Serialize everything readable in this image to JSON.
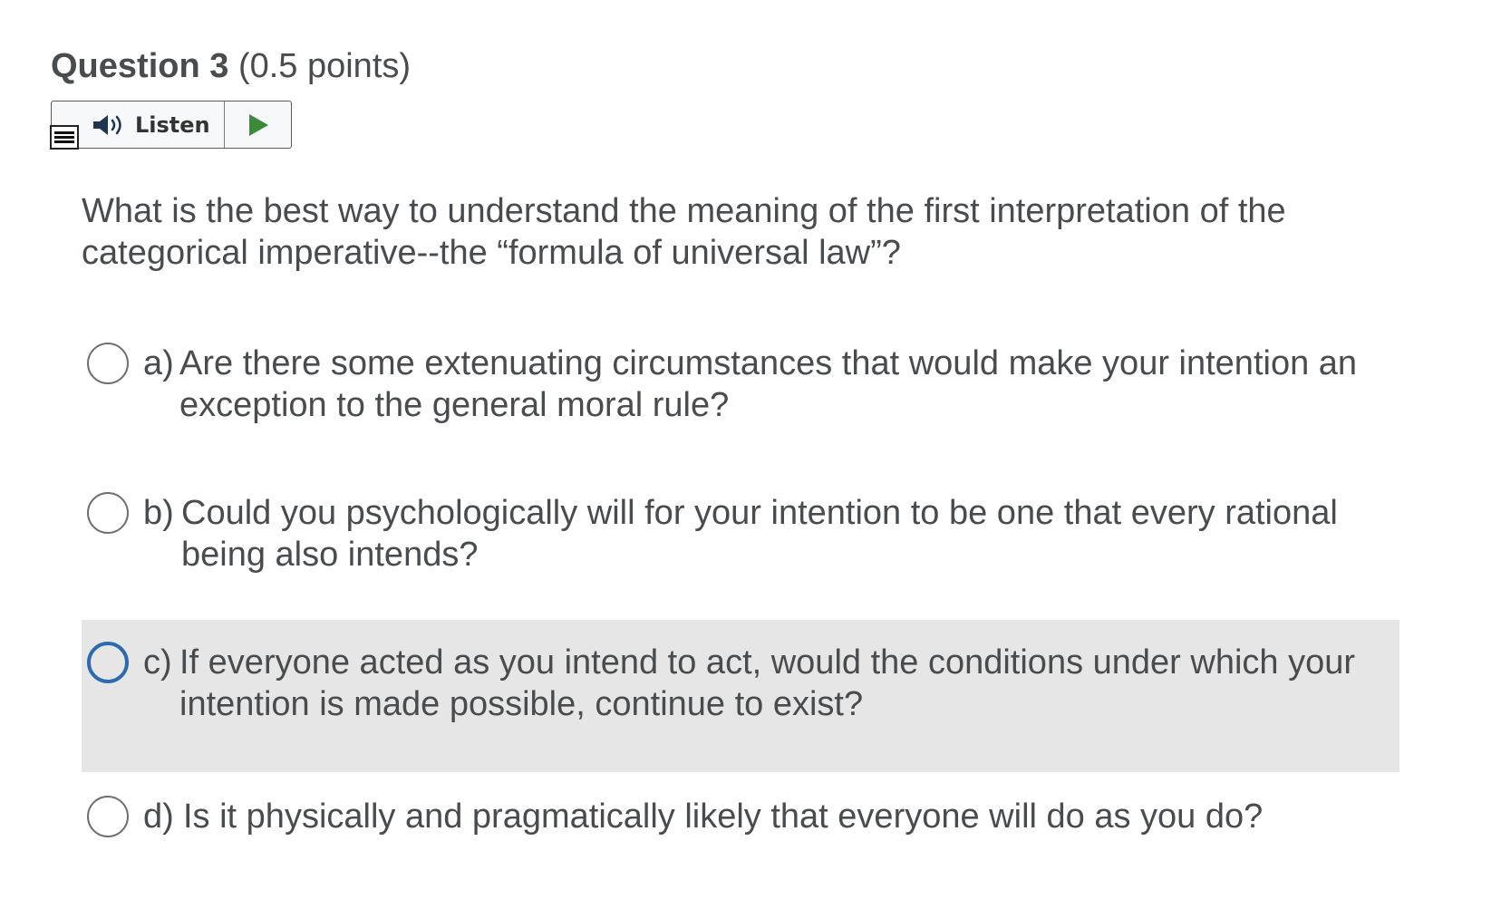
{
  "question": {
    "title": "Question 3",
    "points": "(0.5 points)"
  },
  "listen": {
    "label": "Listen",
    "menu_icon": "menu-lines-icon",
    "speaker_icon": "speaker-icon",
    "play_icon": "play-icon",
    "play_color": "#3a8a3a"
  },
  "prompt": "What is the best way to understand the meaning of the first interpretation of the categorical imperative--the “formula of universal law”?",
  "options": [
    {
      "letter": "a)",
      "text": "Are there some extenuating circumstances that would make your intention an exception to the general moral rule?",
      "selected": false
    },
    {
      "letter": "b)",
      "text": "Could you psychologically will for your intention to be one that every rational being also intends?",
      "selected": false
    },
    {
      "letter": "c)",
      "text": "If everyone acted as you intend to act, would the conditions under which your intention is made possible, continue to exist?",
      "selected": false,
      "highlighted": true
    },
    {
      "letter": "d)",
      "text": "Is it physically and pragmatically likely that everyone will do as you do?",
      "selected": false
    }
  ],
  "colors": {
    "text": "#494c4e",
    "highlight_bg": "#e6e6e6",
    "focus_ring": "#2e6ab0"
  }
}
